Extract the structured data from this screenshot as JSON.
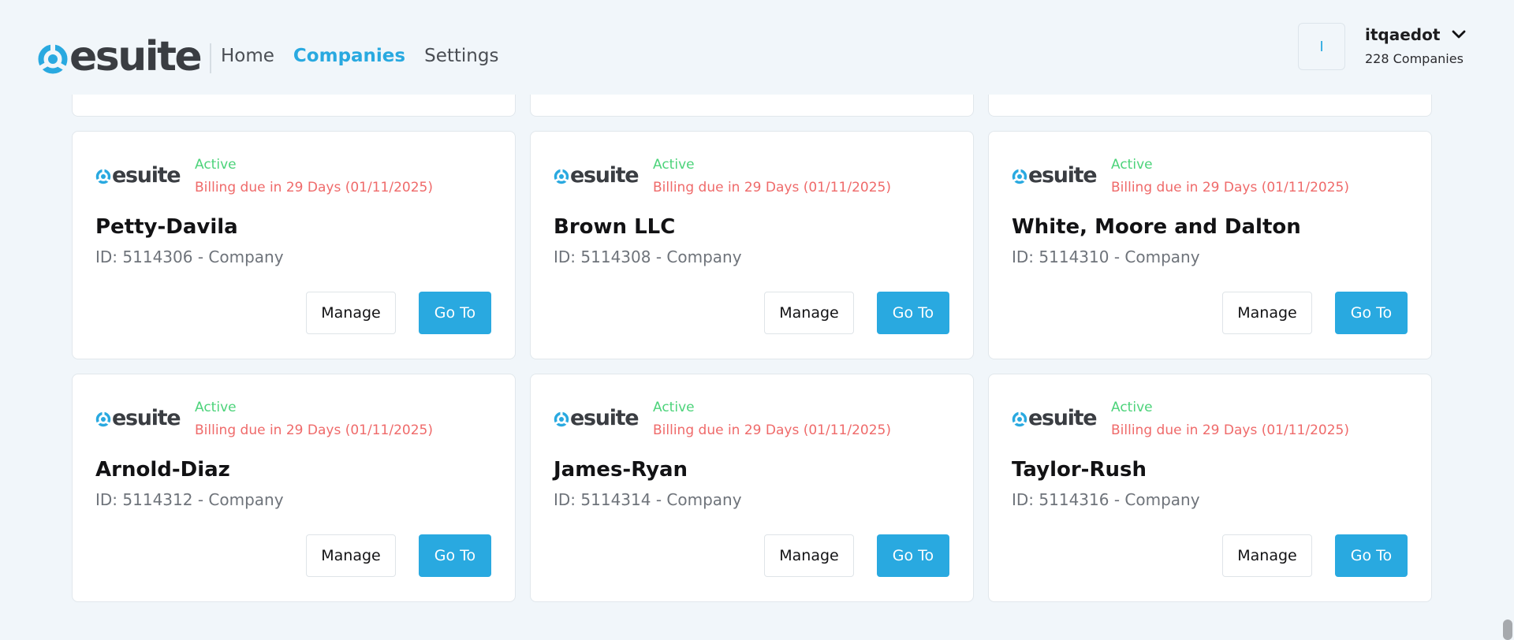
{
  "header": {
    "brand": "esuite",
    "nav": [
      {
        "label": "Home",
        "active": false
      },
      {
        "label": "Companies",
        "active": true
      },
      {
        "label": "Settings",
        "active": false
      }
    ],
    "user": {
      "avatar_initial": "I",
      "name": "itqaedot",
      "companies_count": "228 Companies"
    }
  },
  "colors": {
    "accent": "#29a9e0",
    "status_active": "#4cd37a",
    "billing_warning": "#ef6a6a",
    "background": "#f1f6fa"
  },
  "cards": [
    {
      "brand": "esuite",
      "status": "Active",
      "billing": "Billing due in 29 Days (01/11/2025)",
      "name": "Petty-Davila",
      "id_line": "ID: 5114306 - Company",
      "manage_label": "Manage",
      "goto_label": "Go To"
    },
    {
      "brand": "esuite",
      "status": "Active",
      "billing": "Billing due in 29 Days (01/11/2025)",
      "name": "Brown LLC",
      "id_line": "ID: 5114308 - Company",
      "manage_label": "Manage",
      "goto_label": "Go To"
    },
    {
      "brand": "esuite",
      "status": "Active",
      "billing": "Billing due in 29 Days (01/11/2025)",
      "name": "White, Moore and Dalton",
      "id_line": "ID: 5114310 - Company",
      "manage_label": "Manage",
      "goto_label": "Go To"
    },
    {
      "brand": "esuite",
      "status": "Active",
      "billing": "Billing due in 29 Days (01/11/2025)",
      "name": "Arnold-Diaz",
      "id_line": "ID: 5114312 - Company",
      "manage_label": "Manage",
      "goto_label": "Go To"
    },
    {
      "brand": "esuite",
      "status": "Active",
      "billing": "Billing due in 29 Days (01/11/2025)",
      "name": "James-Ryan",
      "id_line": "ID: 5114314 - Company",
      "manage_label": "Manage",
      "goto_label": "Go To"
    },
    {
      "brand": "esuite",
      "status": "Active",
      "billing": "Billing due in 29 Days (01/11/2025)",
      "name": "Taylor-Rush",
      "id_line": "ID: 5114316 - Company",
      "manage_label": "Manage",
      "goto_label": "Go To"
    }
  ]
}
